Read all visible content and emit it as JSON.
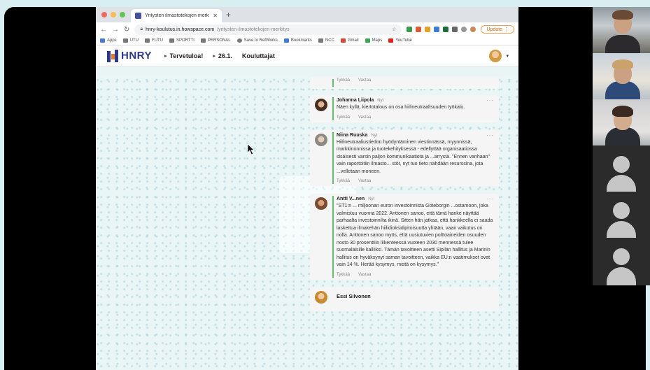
{
  "browser": {
    "tab_title": "Yritysten ilmastotekojen merki",
    "url_host": "hnry-koulutus.in.howspace.com",
    "url_path": "/yritysten-ilmastotekojen-merkitys",
    "update_label": "Update",
    "bookmarks": [
      "Apps",
      "UTU",
      "FUTU",
      "SPORTTI",
      "PERSONAL",
      "Save to RefWorks",
      "Bookmarks",
      "NCC",
      "Gmail",
      "Maps",
      "YouTube"
    ]
  },
  "site": {
    "logo": "HNRY",
    "nav": [
      "Tervetuloa!",
      "26.1.",
      "Kouluttajat"
    ]
  },
  "comment_actions": {
    "like": "Tykkää",
    "reply": "Vastaa"
  },
  "comments": [
    {
      "author": "Johanna Liipola",
      "time": "Nyt",
      "body": "Näen kyllä, kiertotalous on osa hiilineutraalisuuden työkalu."
    },
    {
      "author": "Niina Ruuska",
      "time": "Nyt",
      "body": "Hiilineutraaliustiedon hyödyntäminen viestinnässä, myynnissä, markkinonnissa ja tuotekehityksessä - edellyttää organisaatiossa sisäisesti varsin paljon kommunikaatiota ja ...ärrystä. \"Ennen vanhaan\" vain raportoitiin ilmasto... stöt, nyt tuo tieto nähdään resurssina, jota ...velletaan moneen."
    },
    {
      "author": "Antti V...nen",
      "time": "Nyt",
      "body": "\"ST1:n ... miljoonan euron investoinnista Göteborgin ...ostamoon, joka valmistuu vuonna 2022. Anttonen sanoo, että tämä hanke näyttää parhaalta investoinnilta ikinä. Sitten hän jatkaa, että hankkeella ei saada laskettua ilmakehän hiilidioksidipitoisuutta yhtään, vaan vaikutus on nolla. Anttonen sanoo myös, että uusiutuvien polttoaineiden osuuden nosto 30 prosenttiin liikenteessä vuoteen 2030 mennessä tulee suomalaisille kalliiksi. Tämän tavoitteen asetti Sipilän hallitus ja Marinin hallitus on hyväksynyt saman tavoitteen, vaikka EU:n vaatimukset ovat vain 14 %. Herää kysymys, mistä on kysymys.\""
    },
    {
      "author": "Essi Silvonen",
      "time": "",
      "body": ""
    }
  ],
  "colors": {
    "accent_green": "#5fc26a",
    "brand_blue": "#2b3a8c",
    "content_bg": "#eaf5f6"
  }
}
